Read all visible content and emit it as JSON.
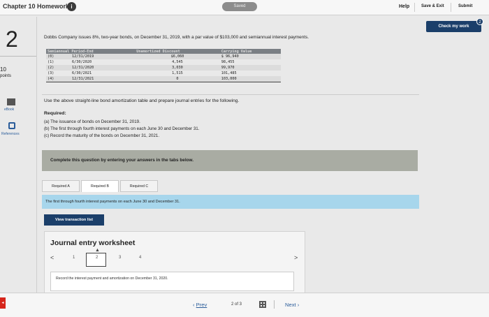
{
  "header": {
    "chapter": "Chapter 10 Homework",
    "saved": "Saved",
    "help": "Help",
    "save_exit": "Save & Exit",
    "submit": "Submit"
  },
  "check_work": {
    "label": "Check my work",
    "badge": "2"
  },
  "question": {
    "number": "2",
    "points_value": "10",
    "points_label": "points",
    "ebook": "eBook",
    "references": "References"
  },
  "problem": {
    "intro": "Dobbs Company issues 8%, two-year bonds, on December 31, 2019, with a par value of $103,000 and semiannual interest payments.",
    "table": {
      "headers": [
        "Semiannual Period-End",
        "Unamortized Discount",
        "Carrying Value"
      ],
      "rows": [
        {
          "n": "(0)",
          "date": "12/31/2019",
          "disc": "$6,060",
          "cv": "$ 96,940"
        },
        {
          "n": "(1)",
          "date": "6/30/2020",
          "disc": "4,545",
          "cv": "98,455"
        },
        {
          "n": "(2)",
          "date": "12/31/2020",
          "disc": "3,030",
          "cv": "99,970"
        },
        {
          "n": "(3)",
          "date": "6/30/2021",
          "disc": "1,515",
          "cv": "101,485"
        },
        {
          "n": "(4)",
          "date": "12/31/2021",
          "disc": "0",
          "cv": "103,000"
        }
      ]
    },
    "instructions": "Use the above straight-line bond amortization table and prepare journal entries for the following.",
    "required_title": "Required:",
    "required_a": "(a) The issuance of bonds on December 31, 2019.",
    "required_b": "(b) The first through fourth interest payments on each June 30 and December 31.",
    "required_c": "(c) Record the maturity of the bonds on December 31, 2021."
  },
  "banner": "Complete this question by entering your answers in the tabs below.",
  "tabs": [
    "Required A",
    "Required B",
    "Required C"
  ],
  "tab_instruction": "The first through fourth interest payments on each June 30 and December 31.",
  "view_transaction_list": "View transaction list",
  "worksheet": {
    "title": "Journal entry worksheet",
    "prev": "<",
    "next": ">",
    "pages": [
      "1",
      "2",
      "3",
      "4"
    ],
    "record_text": "Record the interest payment and amortization on December 31, 2020."
  },
  "footer": {
    "prev": "Prev",
    "page_count": "2 of 3",
    "next": "Next"
  },
  "colors": {
    "accent": "#1b3f6a",
    "banner": "#a9aca3",
    "info_strip": "#a7d6ec",
    "alert": "#d6251b"
  }
}
